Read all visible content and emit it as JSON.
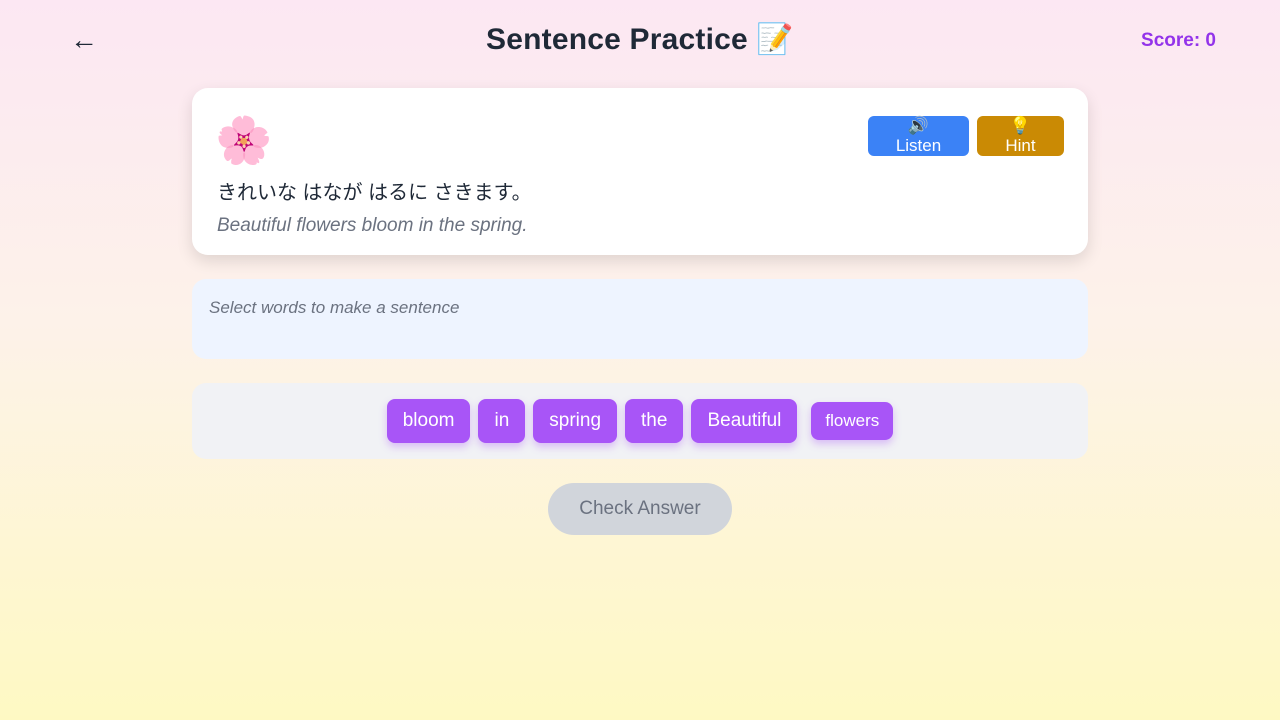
{
  "header": {
    "back_icon": "←",
    "title": "Sentence Practice 📝",
    "score_label": "Score: 0"
  },
  "prompt": {
    "icon": "🌸",
    "japanese": "きれいな はなが はるに さきます。",
    "english": "Beautiful flowers bloom in the spring.",
    "listen_label": "🔊 Listen",
    "hint_label": "💡 Hint"
  },
  "answer": {
    "placeholder": "Select words to make a sentence"
  },
  "word_bank": {
    "words": [
      "bloom",
      "in",
      "spring",
      "the",
      "Beautiful",
      "flowers"
    ]
  },
  "check_label": "Check Answer",
  "colors": {
    "accent": "#a855f7",
    "score": "#9333ea",
    "listen": "#3b82f6",
    "hint": "#ca8a04",
    "disabled": "#d1d5db"
  }
}
